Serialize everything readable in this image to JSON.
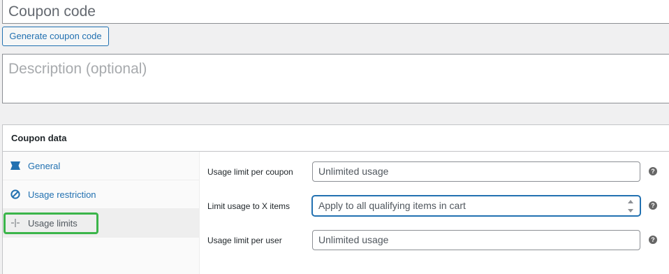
{
  "coupon_code": {
    "placeholder": "Coupon code"
  },
  "generate_button": {
    "label": "Generate coupon code"
  },
  "description": {
    "placeholder": "Description (optional)"
  },
  "coupon_data": {
    "title": "Coupon data",
    "tabs": [
      {
        "label": "General",
        "icon": "ticket-icon"
      },
      {
        "label": "Usage restriction",
        "icon": "block-icon"
      },
      {
        "label": "Usage limits",
        "icon": "limits-icon",
        "active": true
      }
    ],
    "fields": [
      {
        "label": "Usage limit per coupon",
        "placeholder": "Unlimited usage",
        "help": "?"
      },
      {
        "label": "Limit usage to X items",
        "placeholder": "Apply to all qualifying items in cart",
        "help": "?"
      },
      {
        "label": "Usage limit per user",
        "placeholder": "Unlimited usage",
        "help": "?"
      }
    ]
  },
  "colors": {
    "accent": "#2271b1",
    "highlight": "#3bb54a"
  }
}
